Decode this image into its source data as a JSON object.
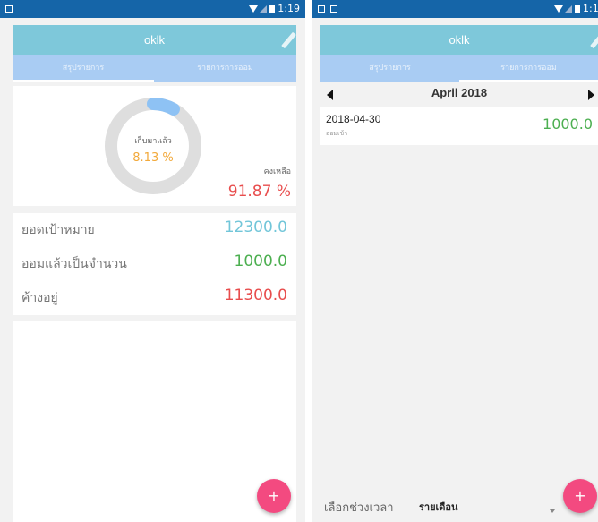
{
  "status": {
    "time": "1:19"
  },
  "left": {
    "title": "oklk",
    "tabs": [
      "สรุปรายการ",
      "รายการการออม"
    ],
    "active_tab": 0,
    "donut": {
      "label": "เก็บมาแล้ว",
      "percent_text": "8.13 %",
      "fraction": 0.0813
    },
    "remaining": {
      "label": "คงเหลือ",
      "value": "91.87 %"
    },
    "rows": [
      {
        "label": "ยอดเป้าหมาย",
        "value": "12300.0",
        "color": "#72c6d9"
      },
      {
        "label": "ออมแล้วเป็นจำนวน",
        "value": "1000.0",
        "color": "#4caf50"
      },
      {
        "label": "ค้างอยู่",
        "value": "11300.0",
        "color": "#e84d4d"
      }
    ],
    "fab_label": "+"
  },
  "right": {
    "title": "oklk",
    "tabs": [
      "สรุปรายการ",
      "รายการการออม"
    ],
    "active_tab": 1,
    "month": "April 2018",
    "entries": [
      {
        "date": "2018-04-30",
        "type": "ออมเข้า",
        "amount": "1000.0"
      }
    ],
    "period_label": "เลือกช่วงเวลา",
    "period_value": "รายเดือน",
    "fab_label": "+"
  },
  "colors": {
    "status_bar": "#1565a8",
    "title_bar": "#7ec8da",
    "tab_bar": "#a9ccf3",
    "fab": "#f34a80",
    "donut_track": "#dedede",
    "donut_fill": "#8ec2f4"
  }
}
